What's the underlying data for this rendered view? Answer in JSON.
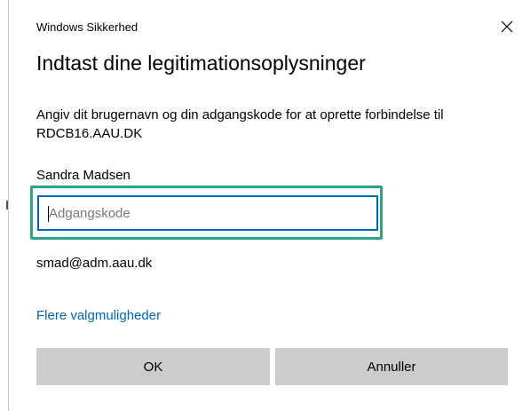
{
  "window": {
    "title": "Windows Sikkerhed",
    "close_icon": "close-icon"
  },
  "dialog": {
    "heading": "Indtast dine legitimationsoplysninger",
    "description": "Angiv dit brugernavn og din adgangskode for at oprette forbindelse til RDCB16.AAU.DK",
    "username": "Sandra Madsen",
    "email": "smad@adm.aau.dk",
    "more_options_link": "Flere valgmuligheder"
  },
  "password_field": {
    "value": "",
    "placeholder": "Adgangskode"
  },
  "buttons": {
    "ok": "OK",
    "cancel": "Annuller"
  },
  "colors": {
    "highlight": "#2aa58a",
    "focus_border": "#0067c0",
    "link": "#0067b8",
    "button_background": "#cccccc"
  }
}
